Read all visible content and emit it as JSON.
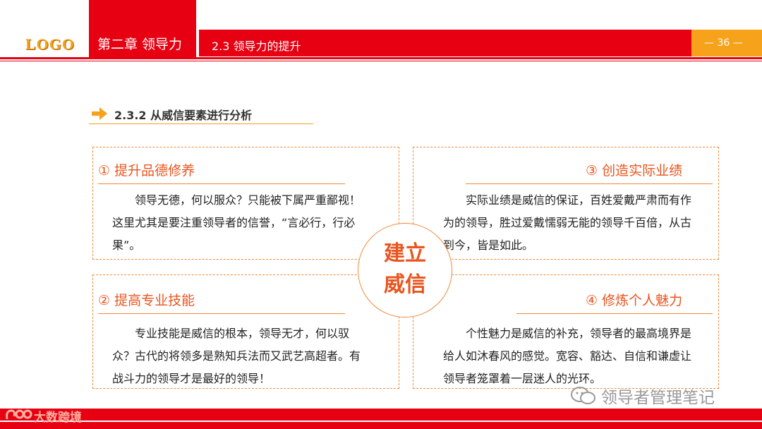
{
  "header": {
    "logo": "LOGO",
    "chapter": "第二章 领导力",
    "section": "2.3 领导力的提升",
    "page_number": "— 36 —"
  },
  "subtitle": "2.3.2 从威信要素进行分析",
  "center_badge": {
    "line1": "建立",
    "line2": "威信"
  },
  "cards": [
    {
      "title": "① 提升品德修养",
      "body": "领导无德，何以服众？只能被下属严重鄙视！这里尤其是要注重领导者的信誉，“言必行，行必果”。"
    },
    {
      "title": "③ 创造实际业绩",
      "body": "实际业绩是威信的保证，百姓爱戴严肃而有作为的领导，胜过爱戴懦弱无能的领导千百倍，从古到今，皆是如此。"
    },
    {
      "title": "② 提高专业技能",
      "body": "专业技能是威信的根本，领导无才，何以驭众？古代的将领多是熟知兵法而又武艺高超者。有战斗力的领导才是最好的领导！"
    },
    {
      "title": "④ 修炼个人魅力",
      "body": "个性魅力是威信的补充，领导者的最高境界是给人如沐春风的感觉。宽容、豁达、自信和谦虚让领导者笼罩着一层迷人的光环。"
    }
  ],
  "footer": {
    "brand": "大数跨境"
  },
  "watermark": "领导者管理笔记",
  "colors": {
    "red": "#E60012",
    "orange": "#F7A21B",
    "accent": "#E8551F"
  }
}
